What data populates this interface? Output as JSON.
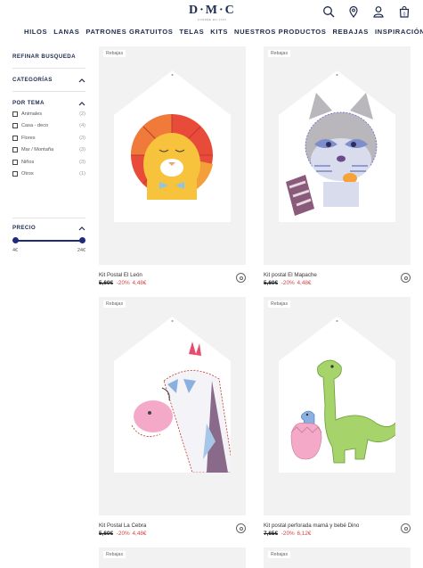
{
  "header": {
    "logo": "D·M·C",
    "logo_sub": "FONDÉE EN 1746",
    "nav": [
      "HILOS",
      "LANAS",
      "PATRONES GRATUITOS",
      "TELAS",
      "KITS",
      "NUESTROS PRODUCTOS",
      "REBAJAS",
      "INSPIRACIÓN"
    ],
    "icons": [
      "search-icon",
      "location-icon",
      "user-icon",
      "cart-icon"
    ],
    "cart_count": "0"
  },
  "sidebar": {
    "refine_title": "REFINAR BUSQUEDA",
    "categories_title": "CATEGORÍAS",
    "theme_title": "POR TEMA",
    "theme_items": [
      {
        "label": "Animales",
        "count": "(2)"
      },
      {
        "label": "Casa - deco",
        "count": "(4)"
      },
      {
        "label": "Flores",
        "count": "(3)"
      },
      {
        "label": "Mar / Montaña",
        "count": "(3)"
      },
      {
        "label": "Niños",
        "count": "(3)"
      },
      {
        "label": "Otros",
        "count": "(1)"
      }
    ],
    "price_title": "PRECIO",
    "price_min": "4€",
    "price_max": "24€"
  },
  "products": [
    {
      "badge": "Rebajas",
      "name": "Kit Postal El León",
      "old_price": "5,60€",
      "discount": "-20%",
      "new_price": "4,48€"
    },
    {
      "badge": "Rebajas",
      "name": "Kit postal El Mapache",
      "old_price": "5,60€",
      "discount": "-20%",
      "new_price": "4,48€"
    },
    {
      "badge": "Rebajas",
      "name": "Kit Postal La Cebra",
      "old_price": "5,60€",
      "discount": "-20%",
      "new_price": "4,48€"
    },
    {
      "badge": "Rebajas",
      "name": "Kit postal perforada mamá y bebé Dino",
      "old_price": "7,65€",
      "discount": "-20%",
      "new_price": "6,12€"
    },
    {
      "badge": "Rebajas"
    },
    {
      "badge": "Rebajas"
    }
  ],
  "colors": {
    "brand": "#1f2a4e",
    "sale": "#d24545",
    "slider": "#1f2a7a"
  }
}
